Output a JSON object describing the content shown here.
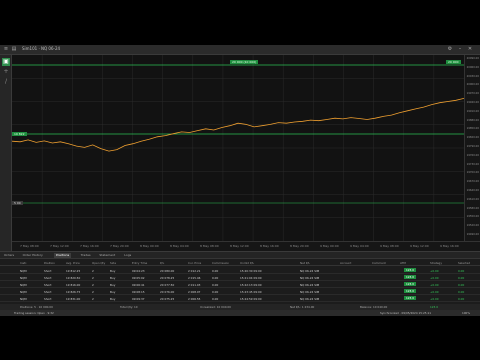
{
  "window": {
    "title": "Sim101 · NQ 06-24"
  },
  "chart": {
    "top_badge": "20 000 (10 000)",
    "right_badge": "20 000",
    "left_badge": "19 822",
    "left_badge_low": "5 00",
    "price_labels": [
      "20090.00",
      "20060.00",
      "20030.00",
      "20000.00",
      "19970.00",
      "19940.00",
      "19910.00",
      "19880.00",
      "19850.00",
      "19820.00",
      "19790.00",
      "19760.00",
      "19730.00",
      "19700.00",
      "19670.00",
      "19640.00",
      "19610.00",
      "19580.00",
      "19550.00",
      "19520.00",
      "19490.00"
    ],
    "time_labels": [
      "7 May 08:00",
      "7 May 12:00",
      "7 May 16:00",
      "7 May 20:00",
      "8 May 00:00",
      "8 May 04:00",
      "8 May 08:00",
      "8 May 12:00",
      "8 May 16:00",
      "8 May 20:00",
      "9 May 00:00",
      "9 May 04:00",
      "9 May 08:00",
      "9 May 12:00",
      "9 May 16:00"
    ],
    "colors": {
      "line": "#f0a030",
      "level": "#2bbf55"
    }
  },
  "chart_data": {
    "type": "line",
    "series": [
      {
        "values": [
          19812,
          19810,
          19816,
          19808,
          19813,
          19806,
          19810,
          19804,
          19796,
          19792,
          19800,
          19788,
          19780,
          19785,
          19798,
          19804,
          19812,
          19818,
          19826,
          19830,
          19836,
          19842,
          19840,
          19846,
          19852,
          19848,
          19856,
          19862,
          19870,
          19866,
          19858,
          19862,
          19866,
          19872,
          19870,
          19874,
          19876,
          19880,
          19878,
          19882,
          19886,
          19884,
          19888,
          19885,
          19882,
          19886,
          19892,
          19896,
          19904,
          19910,
          19916,
          19922,
          19930,
          19936,
          19940,
          19944,
          19950
        ]
      }
    ]
  },
  "tabs": [
    "Orders",
    "Order History",
    "Positions",
    "Trades",
    "Statement",
    "Logs"
  ],
  "active_tab": "Positions",
  "columns": [
    "Instr.",
    "Position",
    "Avg. Price",
    "Open Qty",
    "Side",
    "Entry Time",
    "P/L",
    "Cur. Price",
    "Commission",
    "Unrlzd P/L",
    "Net P/L",
    "Account",
    "Comment",
    "ATM",
    "Strategy",
    "Selected"
  ],
  "rows": [
    [
      "NQM",
      "Short",
      "19 812.25",
      "2",
      "Buy",
      "09:04:23",
      "20 080.00",
      "2 012.21",
      "0.00",
      "15:20:30 09:00",
      "NQ 06-24 SIM",
      "",
      "",
      "",
      "",
      ""
    ],
    [
      "NQM",
      "Short",
      "19 820.50",
      "2",
      "Buy",
      "09:05:02",
      "20 078.25",
      "2 015.46",
      "0.00",
      "15:21:04 09:00",
      "NQ 06-24 SIM",
      "",
      "",
      "",
      "",
      ""
    ],
    [
      "NQM",
      "Short",
      "19 816.00",
      "2",
      "Buy",
      "09:06:41",
      "20 077.50",
      "2 011.03",
      "0.00",
      "15:22:13 09:00",
      "NQ 06-24 SIM",
      "",
      "",
      "",
      "",
      ""
    ],
    [
      "NQM",
      "Short",
      "19 826.75",
      "2",
      "Buy",
      "09:08:15",
      "20 076.00",
      "2 008.97",
      "0.00",
      "15:23:45 09:00",
      "NQ 06-24 SIM",
      "",
      "",
      "",
      "",
      ""
    ],
    [
      "NQM",
      "Short",
      "19 831.00",
      "2",
      "Buy",
      "09:09:37",
      "20 075.25",
      "2 006.55",
      "0.00",
      "15:24:59 09:00",
      "NQ 06-24 SIM",
      "",
      "",
      "",
      "",
      ""
    ]
  ],
  "rows_right": [
    [
      "123.0",
      "+0.00",
      "0.00"
    ],
    [
      "123.0",
      "+0.00",
      "0.00"
    ],
    [
      "123.0",
      "+0.00",
      "0.00"
    ],
    [
      "123.0",
      "+0.00",
      "0.00"
    ],
    [
      "123.0",
      "+0.00",
      "0.00"
    ]
  ],
  "summary": {
    "left": "Positions: 5 · 10 000.00",
    "mid1": "Total Qty: 10",
    "mid2": "Unrealized: 10 040.00",
    "right1": "Net P/L: 1 234.00",
    "right2": "Balance: 10 040.00",
    "right3": "123.0"
  },
  "status": {
    "left": "Trading session: Open · 9:32",
    "right": "Synchronized · 09/05/2024 15:25:11",
    "zoom": "100%"
  }
}
